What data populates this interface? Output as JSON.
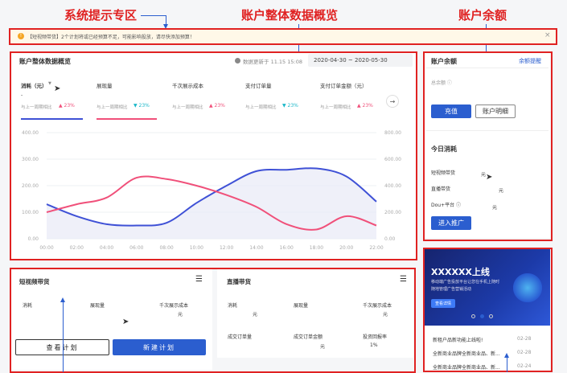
{
  "annotations": {
    "system_notice": "系统提示专区",
    "overview": "账户整体数据概览",
    "balance": "账户余额"
  },
  "notice": {
    "text": "【短视频带货】2个计划将或已经预算不足，可能影响投放，请尽快添加预算！",
    "close": "×"
  },
  "overview": {
    "title": "账户整体数据概览",
    "update_text": "数据更新于 11.15 15:08",
    "date_range": "2020-04-30 ~ 2020-05-30",
    "metrics": [
      {
        "label": "消耗（元）",
        "compare": "与上一周期相比",
        "change": "▲ 23%"
      },
      {
        "label": "展现量",
        "compare": "与上一周期相比",
        "change": "▼ 23%"
      },
      {
        "label": "千次展示成本",
        "compare": "与上一周期相比",
        "change": "▲ 23%"
      },
      {
        "label": "支付订单量",
        "compare": "与上一周期相比",
        "change": "▼ 23%"
      },
      {
        "label": "支付订单金额（元）",
        "compare": "与上一周期相比",
        "change": "▲ 23%"
      }
    ],
    "next": "→",
    "dash": "-"
  },
  "chart_data": {
    "type": "line",
    "x": [
      "00:00",
      "02:00",
      "04:00",
      "06:00",
      "08:00",
      "10:00",
      "12:00",
      "14:00",
      "16:00",
      "18:00",
      "20:00",
      "22:00"
    ],
    "yticks_left": [
      "400.00",
      "300.00",
      "200.00",
      "100.00",
      "0.00"
    ],
    "yticks_right": [
      "800.00",
      "600.00",
      "400.00",
      "200.00",
      "0.00"
    ],
    "ylim": [
      0,
      400
    ],
    "series": [
      {
        "color": "#3f51d6",
        "values": [
          130,
          85,
          55,
          50,
          60,
          135,
          200,
          255,
          260,
          265,
          235,
          140
        ]
      },
      {
        "color": "#f0507a",
        "values": [
          100,
          130,
          155,
          230,
          225,
          200,
          165,
          120,
          55,
          35,
          85,
          50
        ]
      }
    ],
    "grid": true
  },
  "balance": {
    "title": "账户余额",
    "link": "余额提醒",
    "total_label": "总余额 ⓘ",
    "recharge": "充值",
    "detail": "账户明细"
  },
  "today": {
    "title": "今日消耗",
    "rows": [
      {
        "label": "短视频带货",
        "value": "元"
      },
      {
        "label": "直播带货",
        "value": "元"
      },
      {
        "label": "Dou+平台 ⓘ",
        "value": "元"
      }
    ],
    "enter": "进入推广"
  },
  "short_video": {
    "title": "短视频带货",
    "menu": "☰",
    "cols": [
      "消耗",
      "展现量",
      "千次展示成本"
    ],
    "values": [
      "",
      "",
      "元"
    ],
    "view": "查看计划",
    "create": "新建计划"
  },
  "live": {
    "title": "直播带货",
    "menu": "☰",
    "cols1": [
      "消耗",
      "展现量",
      "千次展示成本"
    ],
    "values1": [
      "元",
      "",
      "元"
    ],
    "cols2": [
      "成交订单量",
      "成交订单金额",
      "投资回报率"
    ],
    "values2": [
      "",
      "元",
      "1%"
    ]
  },
  "banner": {
    "title": "XXXXXX上线",
    "line1": "移动端广告投放平台让您在手机上随时",
    "line2": "随地管理广告营销活动",
    "button": "查看详情"
  },
  "news": [
    {
      "text": "新租户品新功能上线啦!",
      "date": "02-28"
    },
    {
      "text": "全新商业品牌全新商业品、新...",
      "date": "02-28"
    },
    {
      "text": "全新商业品牌全新商业品、新...",
      "date": "02-24"
    }
  ],
  "colors": {
    "primary": "#2b5ecf",
    "accent_red": "#e02222",
    "line_blue": "#3f51d6",
    "line_pink": "#f0507a"
  }
}
